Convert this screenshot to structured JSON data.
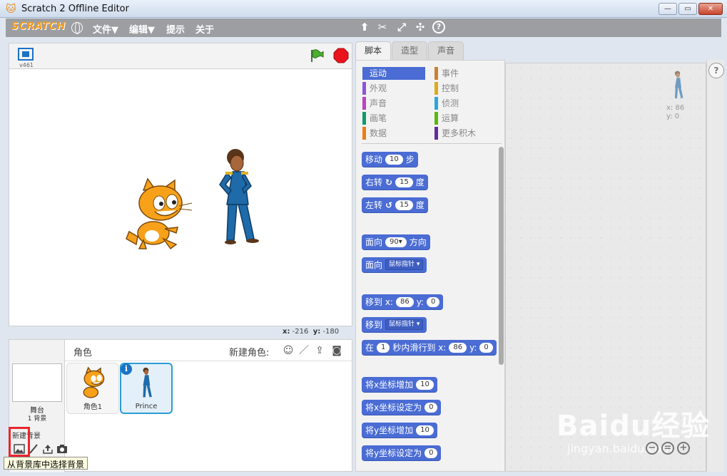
{
  "window": {
    "title": "Scratch 2 Offline Editor"
  },
  "menubar": {
    "logo": "SCRATCH",
    "items": [
      "文件▼",
      "编辑▼",
      "提示",
      "关于"
    ]
  },
  "stage": {
    "version": "v461",
    "coords": {
      "x_label": "x:",
      "x": "-216",
      "y_label": "y:",
      "y": "-180"
    }
  },
  "sprites": {
    "title": "角色",
    "new_sprite": "新建角色:",
    "items": [
      {
        "name": "角色1"
      },
      {
        "name": "Prince"
      }
    ]
  },
  "stage_panel": {
    "label": "舞台",
    "backdrop_count": "1 背景",
    "new_backdrop": "新建背景"
  },
  "tooltip": "从背景库中选择背景",
  "tabs": [
    "脚本",
    "造型",
    "声音"
  ],
  "categories": [
    {
      "label": "运动",
      "color": "#4a6cd4"
    },
    {
      "label": "事件",
      "color": "#c88330"
    },
    {
      "label": "外观",
      "color": "#8a55d7"
    },
    {
      "label": "控制",
      "color": "#e1a91a"
    },
    {
      "label": "声音",
      "color": "#bb42c3"
    },
    {
      "label": "侦测",
      "color": "#2ca5e2"
    },
    {
      "label": "画笔",
      "color": "#0e9a6c"
    },
    {
      "label": "运算",
      "color": "#5cb712"
    },
    {
      "label": "数据",
      "color": "#ee7d16"
    },
    {
      "label": "更多积木",
      "color": "#632d99"
    }
  ],
  "blocks": {
    "move": {
      "a": "移动",
      "v": "10",
      "b": "步"
    },
    "turn_right": {
      "a": "右转",
      "v": "15",
      "b": "度"
    },
    "turn_left": {
      "a": "左转",
      "v": "15",
      "b": "度"
    },
    "point_dir": {
      "a": "面向",
      "v": "90",
      "b": "方向"
    },
    "point_towards": {
      "a": "面向",
      "v": "鼠标指针"
    },
    "goto_xy": {
      "a": "移到 x:",
      "x": "86",
      "b": "y:",
      "y": "0"
    },
    "goto": {
      "a": "移到",
      "v": "鼠标指针"
    },
    "glide": {
      "a": "在",
      "v": "1",
      "b": "秒内滑行到 x:",
      "x": "86",
      "c": "y:",
      "y": "0"
    },
    "change_x": {
      "a": "将x坐标增加",
      "v": "10"
    },
    "set_x": {
      "a": "将x坐标设定为",
      "v": "0"
    },
    "change_y": {
      "a": "将y坐标增加",
      "v": "10"
    },
    "set_y": {
      "a": "将y坐标设定为",
      "v": "0"
    }
  },
  "sprite_info": {
    "x_label": "x:",
    "x": "86",
    "y_label": "y:",
    "y": "0"
  },
  "watermark": {
    "text": "Baidu经验",
    "url": "jingyan.baidu.com"
  }
}
